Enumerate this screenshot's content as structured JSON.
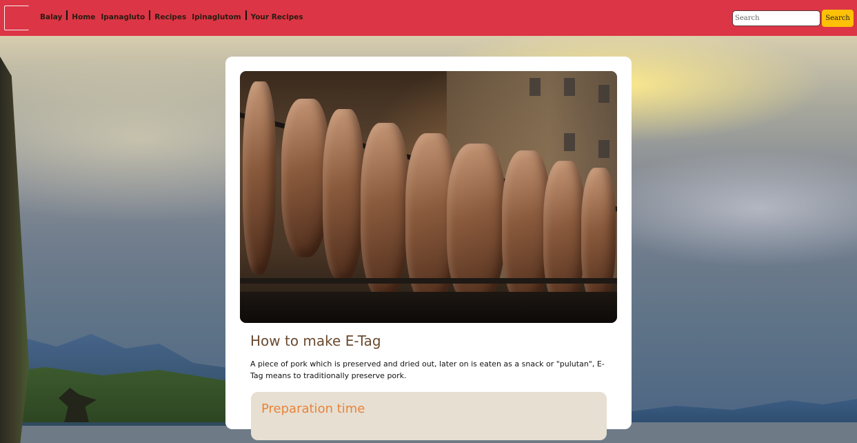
{
  "nav": {
    "brand_logo_alt": "",
    "links": [
      "Balay",
      "Home",
      "Ipanagluto",
      "Recipes",
      "Ipinaglutom",
      "Your Recipes"
    ]
  },
  "search": {
    "placeholder": "Search",
    "button_label": "Search"
  },
  "article": {
    "hero_image": "hanging dried pork (E-Tag) photo",
    "title": "How to make E-Tag",
    "description": "A piece of pork which is preserved and dried out, later on is eaten as a snack or \"pulutan\", E-Tag means to traditionally preserve pork.",
    "section_title": "Preparation time"
  },
  "colors": {
    "navbar": "#dc3545",
    "search_button": "#ffc107",
    "title": "#6a4a30",
    "section_title": "#e8833a",
    "section_bg": "#e6dfd2"
  }
}
